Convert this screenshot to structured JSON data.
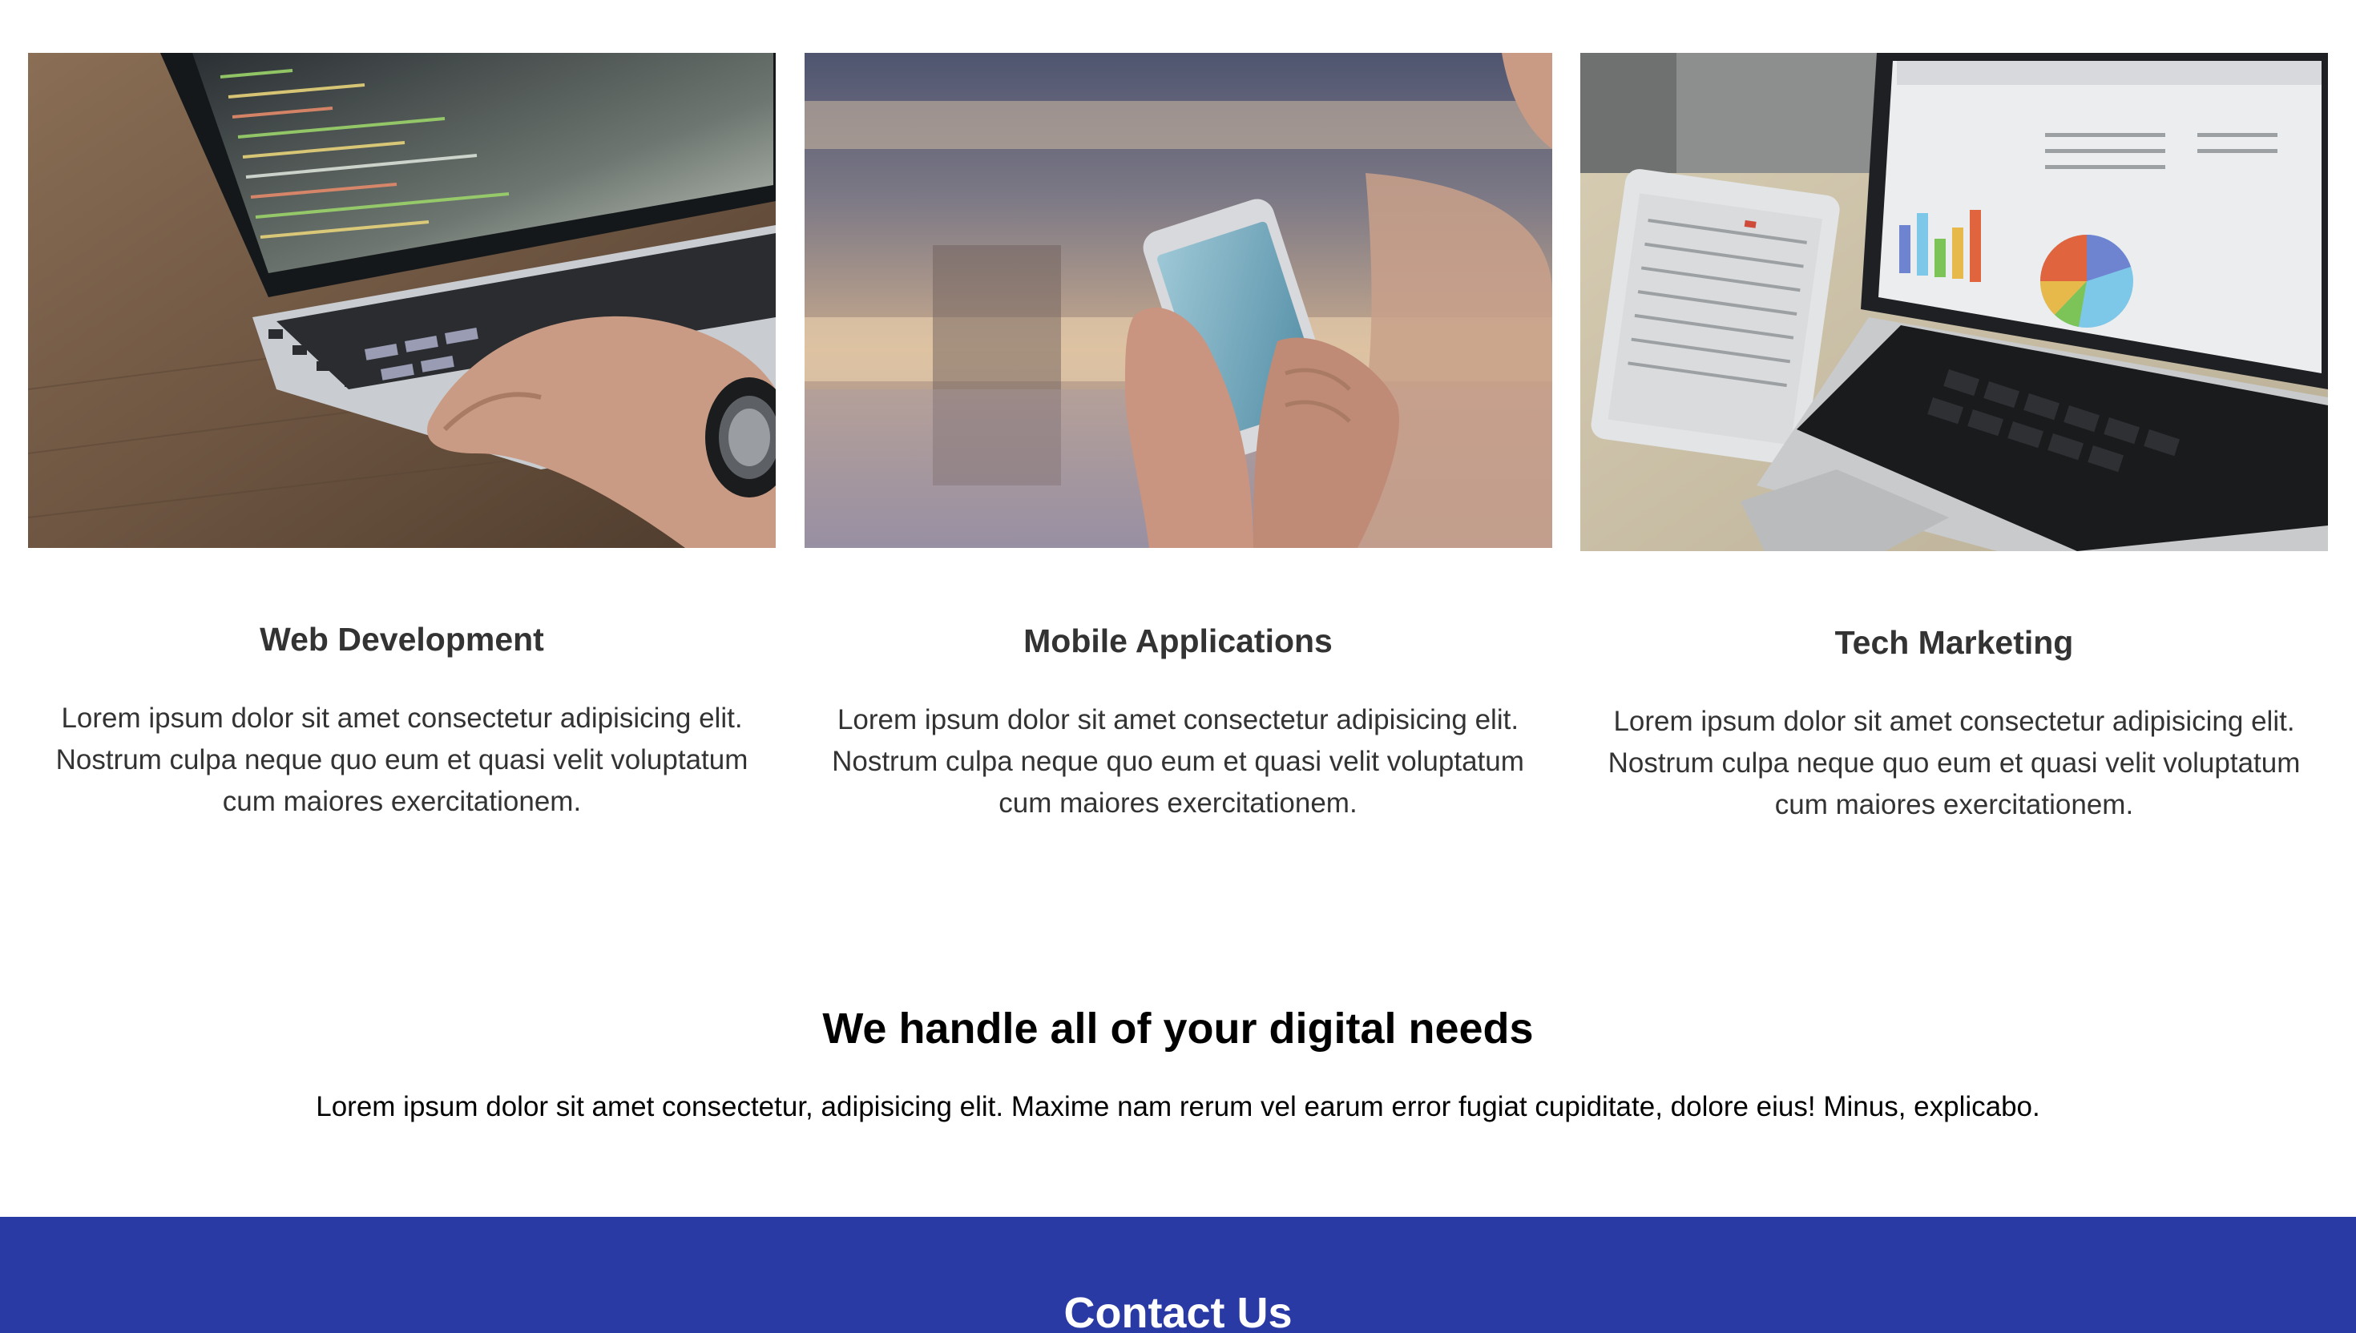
{
  "services": [
    {
      "image": "laptop-coding-photo",
      "title": "Web Development",
      "text": "Lorem ipsum dolor sit amet consectetur adipisicing elit. Nostrum culpa neque quo eum et quasi velit voluptatum cum maiores exercitationem."
    },
    {
      "image": "smartphone-in-hands-photo",
      "title": "Mobile Applications",
      "text": "Lorem ipsum dolor sit amet consectetur adipisicing elit. Nostrum culpa neque quo eum et quasi velit voluptatum cum maiores exercitationem."
    },
    {
      "image": "laptop-tablet-charts-photo",
      "title": "Tech Marketing",
      "text": "Lorem ipsum dolor sit amet consectetur adipisicing elit. Nostrum culpa neque quo eum et quasi velit voluptatum cum maiores exercitationem."
    }
  ],
  "needs": {
    "title": "We handle all of your digital needs",
    "text": "Lorem ipsum dolor sit amet consectetur, adipisicing elit. Maxime nam rerum vel earum error fugiat cupiditate, dolore eius! Minus, explicabo."
  },
  "contact": {
    "title": "Contact Us",
    "background": "#2a3aa5"
  }
}
